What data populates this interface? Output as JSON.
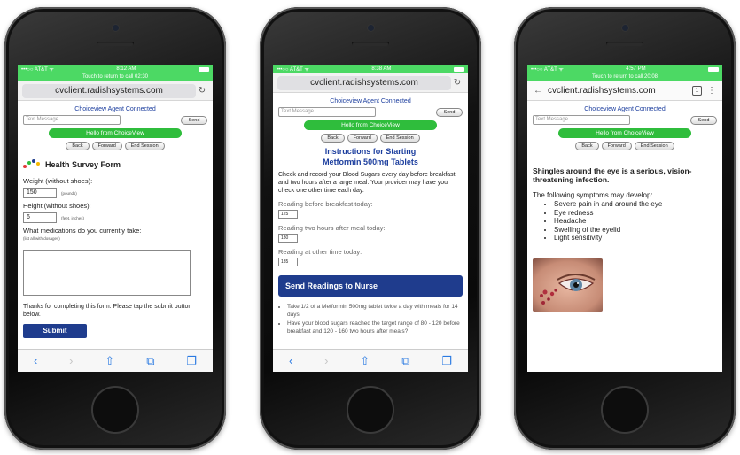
{
  "phone1": {
    "status_carrier": "•••○○ AT&T ᯤ",
    "status_time": "8:12 AM",
    "call_banner": "Touch to return to call 02:30",
    "url": "cvclient.radishsystems.com",
    "agent_connected": "Choiceview Agent Connected",
    "text_message_placeholder": "Text Message",
    "send_label": "Send",
    "hello_label": "Hello from ChoiceView",
    "back_label": "Back",
    "forward_label": "Forward",
    "end_session_label": "End Session",
    "form_title": "Health Survey Form",
    "weight_label": "Weight (without shoes):",
    "weight_value": "150",
    "weight_unit": "(pounds)",
    "height_label": "Height (without shoes):",
    "height_value": "6",
    "height_unit": "(feet, inches)",
    "medications_label": "What medications do you currently take:",
    "medications_hint": "(list all with dosages)",
    "thanks_text": "Thanks for completing this form. Please tap the submit button below.",
    "submit_label": "Submit"
  },
  "phone2": {
    "status_carrier": "•••○○ AT&T ᯤ",
    "status_time": "8:38 AM",
    "url": "cvclient.radishsystems.com",
    "agent_connected": "Choiceview Agent Connected",
    "text_message_placeholder": "Text Message",
    "send_label": "Send",
    "hello_label": "Hello from ChoiceView",
    "back_label": "Back",
    "forward_label": "Forward",
    "end_session_label": "End Session",
    "title_line1": "Instructions for Starting",
    "title_line2": "Metformin 500mg Tablets",
    "instructions": "Check and record your Blood Sugars every day before breakfast and two hours after a large meal. Your provider may have you check one other time each day.",
    "reading1_label": "Reading before breakfast today:",
    "reading1_value": "125",
    "reading2_label": "Reading two hours after meal today:",
    "reading2_value": "130",
    "reading3_label": "Reading at other time today:",
    "reading3_value": "135",
    "send_readings_label": "Send Readings to Nurse",
    "bullets": [
      "Take 1/2 of a Metformin 500mg tablet twice a day with meals for 14 days.",
      "Have your blood sugars reached the target range of 80 - 120 before breakfast and 120 - 160 two hours after meals?"
    ]
  },
  "phone3": {
    "status_carrier": "•••○○ AT&T ᯤ",
    "status_time": "4:57 PM",
    "call_banner": "Touch to return to call 20:08",
    "url": "cvclient.radishsystems.com",
    "tabs_count": "1",
    "agent_connected": "Choiceview Agent Connected",
    "text_message_placeholder": "Text Message",
    "send_label": "Send",
    "hello_label": "Hello from ChoiceView",
    "back_label": "Back",
    "forward_label": "Forward",
    "end_session_label": "End Session",
    "headline": "Shingles around the eye is a serious, vision-threatening infection.",
    "symptoms_intro": "The following symptoms may develop:",
    "symptoms": [
      "Severe pain in and around the eye",
      "Eye redness",
      "Headache",
      "Swelling of the eyelid",
      "Light sensitivity"
    ]
  },
  "colors": {
    "status_green": "#4cd964",
    "choiceview_green": "#2fbd3c",
    "brand_blue": "#1f3c8d",
    "link_blue": "#1c3e9e"
  }
}
